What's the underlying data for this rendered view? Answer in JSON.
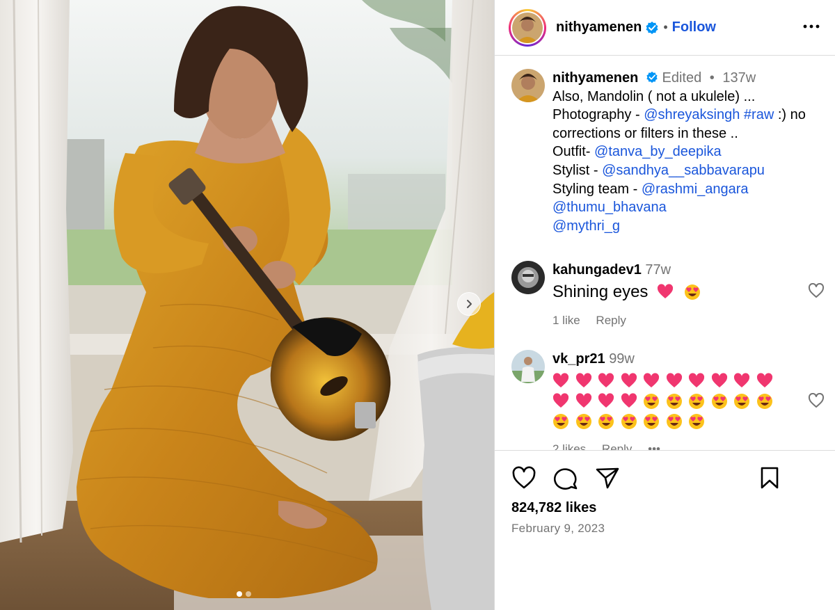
{
  "header": {
    "username": "nithyamenen",
    "separator": "•",
    "follow_label": "Follow"
  },
  "caption": {
    "username": "nithyamenen",
    "edited": "Edited",
    "dot": "•",
    "age": "137w",
    "line1": "Also,  Mandolin ( not a ukulele) ...",
    "line2_prefix": "Photography - ",
    "line2_mention": "@shreyaksingh",
    "line2_tag": " #raw",
    "line2_suffix": " :) no",
    "line3": "corrections or filters in these ..",
    "line4_prefix": "Outfit- ",
    "line4_mention": "@tanva_by_deepika",
    "line5_prefix": "Stylist - ",
    "line5_mention": "@sandhya__sabbavarapu",
    "line6_prefix": "Styling team - ",
    "line6_mention": "@rashmi_angara",
    "line7_mention": "@thumu_bhavana",
    "line8_mention": "@mythri_g"
  },
  "comments": [
    {
      "username": "kahungadev1",
      "age": "77w",
      "text": "Shining eyes",
      "likes": "1 like",
      "reply": "Reply"
    },
    {
      "username": "vk_pr21",
      "age": "99w",
      "likes": "2 likes",
      "reply": "Reply",
      "more": "•••"
    }
  ],
  "engagement": {
    "likes": "824,782 likes",
    "date": "February 9, 2023"
  },
  "carousel": {
    "slide_index": 1,
    "slide_count": 2
  },
  "colors": {
    "link": "#1a56db",
    "verified": "#0095f6",
    "secondary_text": "#737373",
    "border": "#dbdbdb"
  },
  "icons": [
    "verified-badge-icon",
    "more-options-icon",
    "heart-icon",
    "comment-icon",
    "share-icon",
    "bookmark-icon",
    "chevron-right-icon",
    "pink-heart-emoji",
    "heart-eyes-emoji"
  ]
}
